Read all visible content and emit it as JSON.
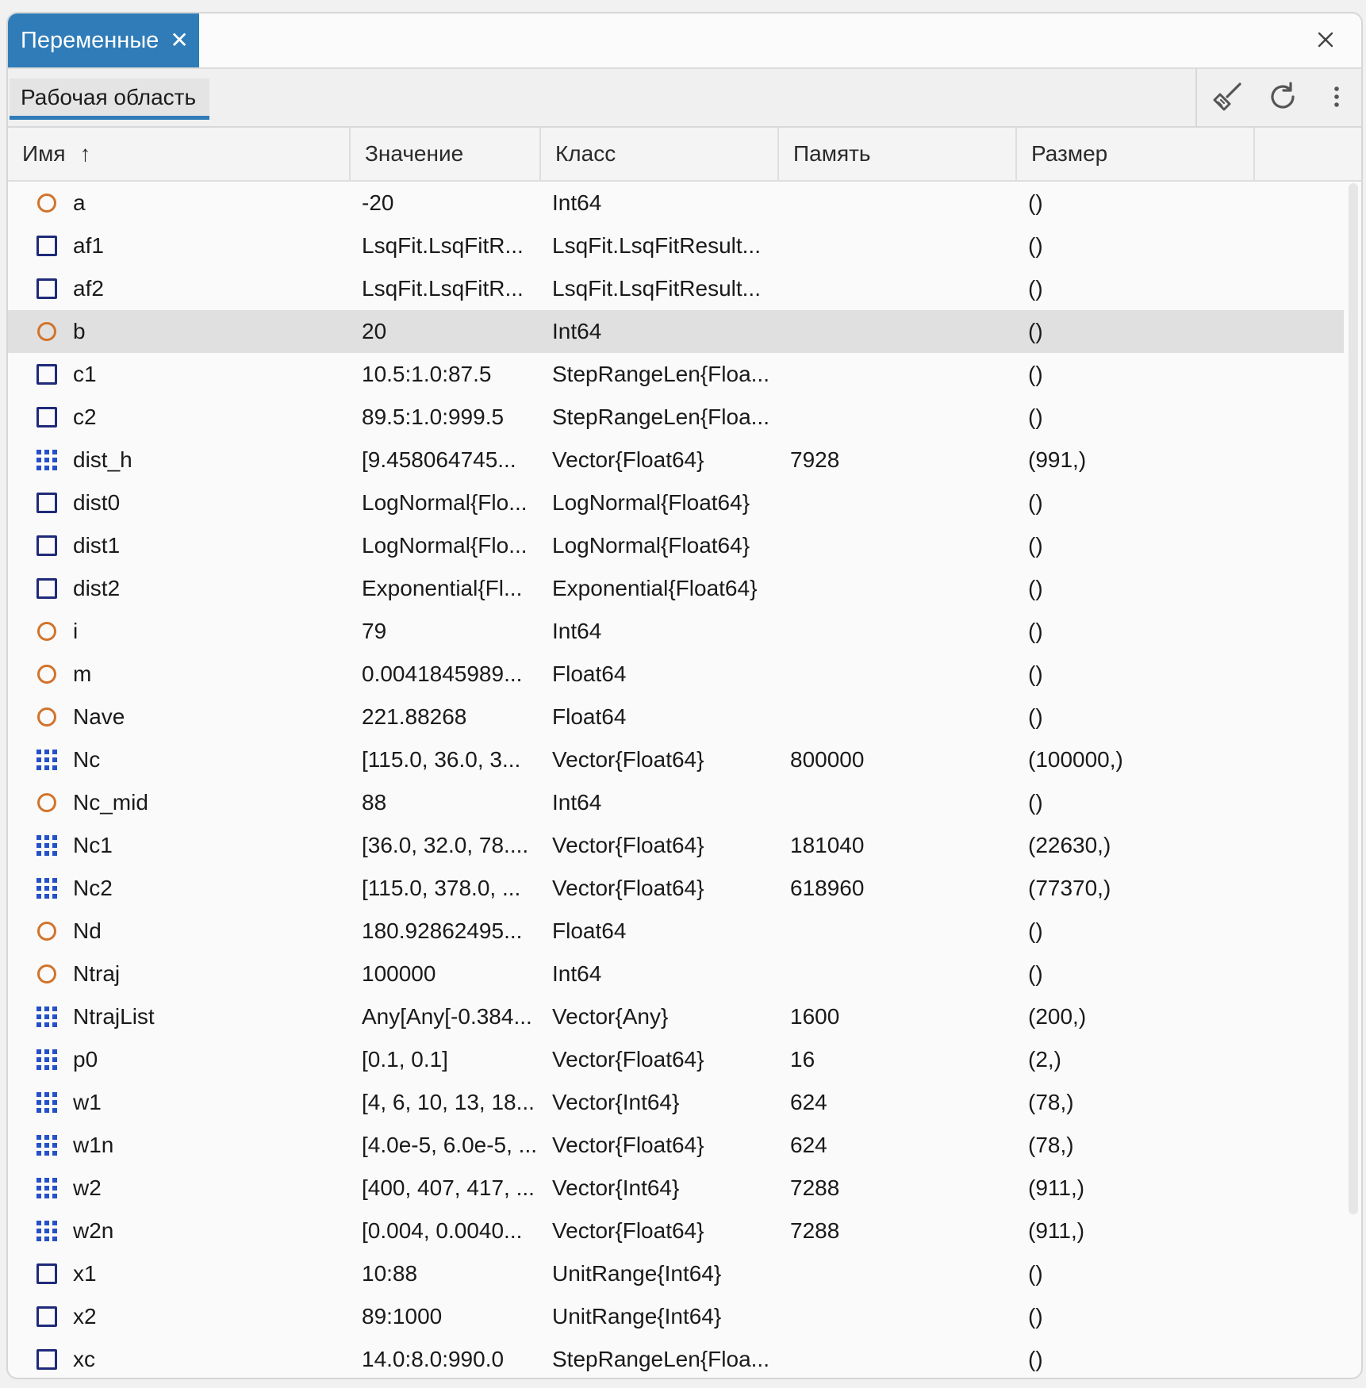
{
  "tabs": {
    "active_label": "Переменные"
  },
  "toolbar": {
    "workspace_label": "Рабочая область"
  },
  "columns": {
    "name": "Имя",
    "value": "Значение",
    "class": "Класс",
    "memory": "Память",
    "size": "Размер"
  },
  "selected_row": "b",
  "rows": [
    {
      "icon": "scalar-icon",
      "name": "a",
      "value": "-20",
      "class": "Int64",
      "memory": "",
      "size": "()"
    },
    {
      "icon": "object-icon",
      "name": "af1",
      "value": "LsqFit.LsqFitR...",
      "class": "LsqFit.LsqFitResult...",
      "memory": "",
      "size": "()"
    },
    {
      "icon": "object-icon",
      "name": "af2",
      "value": "LsqFit.LsqFitR...",
      "class": "LsqFit.LsqFitResult...",
      "memory": "",
      "size": "()"
    },
    {
      "icon": "scalar-icon",
      "name": "b",
      "value": "20",
      "class": "Int64",
      "memory": "",
      "size": "()"
    },
    {
      "icon": "object-icon",
      "name": "c1",
      "value": "10.5:1.0:87.5",
      "class": "StepRangeLen{Floa...",
      "memory": "",
      "size": "()"
    },
    {
      "icon": "object-icon",
      "name": "c2",
      "value": "89.5:1.0:999.5",
      "class": "StepRangeLen{Floa...",
      "memory": "",
      "size": "()"
    },
    {
      "icon": "array-icon",
      "name": "dist_h",
      "value": "[9.458064745...",
      "class": "Vector{Float64}",
      "memory": "7928",
      "size": "(991,)"
    },
    {
      "icon": "object-icon",
      "name": "dist0",
      "value": "LogNormal{Flo...",
      "class": "LogNormal{Float64}",
      "memory": "",
      "size": "()"
    },
    {
      "icon": "object-icon",
      "name": "dist1",
      "value": "LogNormal{Flo...",
      "class": "LogNormal{Float64}",
      "memory": "",
      "size": "()"
    },
    {
      "icon": "object-icon",
      "name": "dist2",
      "value": "Exponential{Fl...",
      "class": "Exponential{Float64}",
      "memory": "",
      "size": "()"
    },
    {
      "icon": "scalar-icon",
      "name": "i",
      "value": "79",
      "class": "Int64",
      "memory": "",
      "size": "()"
    },
    {
      "icon": "scalar-icon",
      "name": "m",
      "value": "0.0041845989...",
      "class": "Float64",
      "memory": "",
      "size": "()"
    },
    {
      "icon": "scalar-icon",
      "name": "Nave",
      "value": "221.88268",
      "class": "Float64",
      "memory": "",
      "size": "()"
    },
    {
      "icon": "array-icon",
      "name": "Nc",
      "value": "[115.0, 36.0, 3...",
      "class": "Vector{Float64}",
      "memory": "800000",
      "size": "(100000,)"
    },
    {
      "icon": "scalar-icon",
      "name": "Nc_mid",
      "value": "88",
      "class": "Int64",
      "memory": "",
      "size": "()"
    },
    {
      "icon": "array-icon",
      "name": "Nc1",
      "value": "[36.0, 32.0, 78....",
      "class": "Vector{Float64}",
      "memory": "181040",
      "size": "(22630,)"
    },
    {
      "icon": "array-icon",
      "name": "Nc2",
      "value": "[115.0, 378.0, ...",
      "class": "Vector{Float64}",
      "memory": "618960",
      "size": "(77370,)"
    },
    {
      "icon": "scalar-icon",
      "name": "Nd",
      "value": "180.92862495...",
      "class": "Float64",
      "memory": "",
      "size": "()"
    },
    {
      "icon": "scalar-icon",
      "name": "Ntraj",
      "value": "100000",
      "class": "Int64",
      "memory": "",
      "size": "()"
    },
    {
      "icon": "array-icon",
      "name": "NtrajList",
      "value": "Any[Any[-0.384...",
      "class": "Vector{Any}",
      "memory": "1600",
      "size": "(200,)"
    },
    {
      "icon": "array-icon",
      "name": "p0",
      "value": "[0.1, 0.1]",
      "class": "Vector{Float64}",
      "memory": "16",
      "size": "(2,)"
    },
    {
      "icon": "array-icon",
      "name": "w1",
      "value": "[4, 6, 10, 13, 18...",
      "class": "Vector{Int64}",
      "memory": "624",
      "size": "(78,)"
    },
    {
      "icon": "array-icon",
      "name": "w1n",
      "value": "[4.0e-5, 6.0e-5, ...",
      "class": "Vector{Float64}",
      "memory": "624",
      "size": "(78,)"
    },
    {
      "icon": "array-icon",
      "name": "w2",
      "value": "[400, 407, 417, ...",
      "class": "Vector{Int64}",
      "memory": "7288",
      "size": "(911,)"
    },
    {
      "icon": "array-icon",
      "name": "w2n",
      "value": "[0.004, 0.0040...",
      "class": "Vector{Float64}",
      "memory": "7288",
      "size": "(911,)"
    },
    {
      "icon": "object-icon",
      "name": "x1",
      "value": "10:88",
      "class": "UnitRange{Int64}",
      "memory": "",
      "size": "()"
    },
    {
      "icon": "object-icon",
      "name": "x2",
      "value": "89:1000",
      "class": "UnitRange{Int64}",
      "memory": "",
      "size": "()"
    },
    {
      "icon": "object-icon",
      "name": "xc",
      "value": "14.0:8.0:990.0",
      "class": "StepRangeLen{Floa...",
      "memory": "",
      "size": "()"
    }
  ]
}
